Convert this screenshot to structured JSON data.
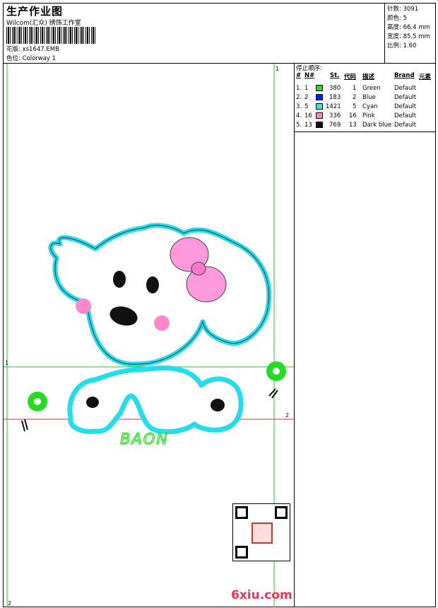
{
  "header": {
    "title": "生产作业图",
    "subtitle": "Wilcom(汇众) 绣饰工作室",
    "design_label": "花版:",
    "design_value": "xs1647.EMB",
    "colorway_label": "色位:",
    "colorway_value": "Colorway 1"
  },
  "stats": [
    {
      "label": "针数:",
      "value": "3091"
    },
    {
      "label": "颜色:",
      "value": "5"
    },
    {
      "label": "高度:",
      "value": "66.4 mm"
    },
    {
      "label": "宽度:",
      "value": "85.5 mm"
    },
    {
      "label": "比例:",
      "value": "1.60"
    }
  ],
  "stop_sequence": {
    "title": "停止顺序:",
    "headers": [
      "#",
      "N#",
      "St.",
      "代码",
      "描述",
      "Brand",
      "元素"
    ],
    "rows": [
      {
        "idx": "1.",
        "n": "1",
        "color": "#22dd22",
        "st": "380",
        "code": "1",
        "desc": "Green",
        "brand": "Default"
      },
      {
        "idx": "2.",
        "n": "2",
        "color": "#0022ee",
        "st": "183",
        "code": "2",
        "desc": "Blue",
        "brand": "Default"
      },
      {
        "idx": "3.",
        "n": "5",
        "color": "#22eeee",
        "st": "1421",
        "code": "5",
        "desc": "Cyan",
        "brand": "Default"
      },
      {
        "idx": "4.",
        "n": "16",
        "color": "#ff88cc",
        "st": "336",
        "code": "16",
        "desc": "Pink",
        "brand": "Default"
      },
      {
        "idx": "5.",
        "n": "13",
        "color": "#111111",
        "st": "769",
        "code": "13",
        "desc": "Dark blue",
        "brand": "Default"
      }
    ]
  },
  "guides": {
    "v1": "1",
    "h1": "1",
    "h2": "2",
    "v2": "2"
  },
  "embroidery_text": "BAON",
  "watermark": "6xiu.com",
  "colors": {
    "green": "#22dd22",
    "cyan": "#22ddee",
    "pink": "#ff88cc",
    "red": "#cc3333",
    "frame": "#000000"
  }
}
